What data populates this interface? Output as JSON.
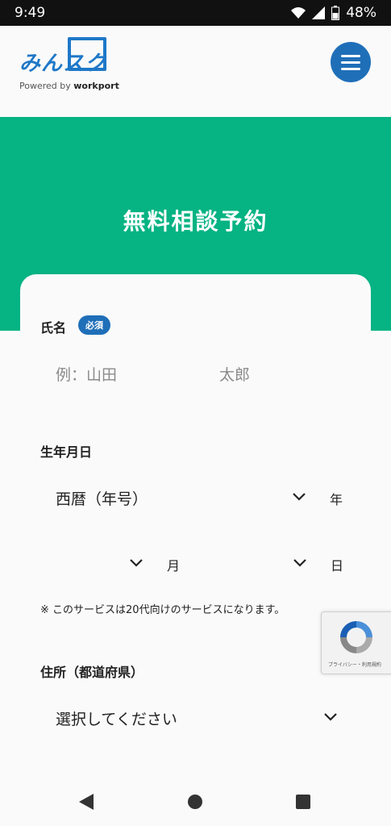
{
  "status_bar": {
    "time": "9:49",
    "battery": "48%"
  },
  "header": {
    "logo_text": "みんスク",
    "logo_sub_prefix": "Powered by ",
    "logo_sub_brand": "workport"
  },
  "banner": {
    "title": "無料相談予約"
  },
  "form": {
    "name": {
      "label": "氏名",
      "required_badge": "必須",
      "last_placeholder": "例：山田",
      "first_placeholder": "太郎"
    },
    "birthdate": {
      "label": "生年月日",
      "era_select": "西暦（年号）",
      "year_unit": "年",
      "month_unit": "月",
      "day_unit": "日",
      "note": "※ このサービスは20代向けのサービスになります。"
    },
    "address": {
      "label": "住所（都道府県）",
      "select_placeholder": "選択してください"
    }
  },
  "recaptcha": {
    "text": "プライバシー・利用規約"
  },
  "colors": {
    "brand_blue": "#1f6fb8",
    "banner_green": "#05b383"
  }
}
